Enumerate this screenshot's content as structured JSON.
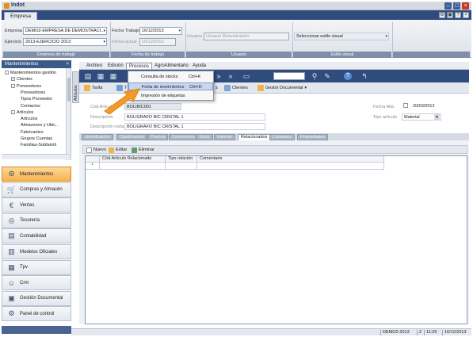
{
  "window": {
    "title": "Indot"
  },
  "ribbon": {
    "tab": "Empresa",
    "empresa_label": "Empresa",
    "empresa_value": "DEMO2-EMPRESA DE DEMOSTRACI...",
    "ejercicio_label": "Ejercicio",
    "ejercicio_value": "2013-EJERCICIO 2013",
    "group_empresa": "Empresa de trabajo",
    "fecha_trabajo_label": "Fecha Trabajo",
    "fecha_trabajo_value": "16/12/2013",
    "fecha_actual_label": "Fecha actual",
    "fecha_actual_value": "16/12/2013",
    "group_fecha": "Fecha de trabajo",
    "usuario_label": "Usuario",
    "usuario_value": "Usuario Demostración",
    "group_usuario": "Usuario",
    "estilo_value": "Seleccionar estilo visual",
    "group_estilo": "Estilo visual"
  },
  "sidebar": {
    "header": "Mantenimientos",
    "tree": [
      {
        "label": "Mantenimientos gestión",
        "indent": 0,
        "expander": "-"
      },
      {
        "label": "Clientes",
        "indent": 1,
        "expander": "+"
      },
      {
        "label": "Proveedores",
        "indent": 1,
        "expander": "-"
      },
      {
        "label": "Proveedores",
        "indent": 2,
        "expander": ""
      },
      {
        "label": "Tipos Proveedor",
        "indent": 2,
        "expander": ""
      },
      {
        "label": "Contactos",
        "indent": 2,
        "expander": ""
      },
      {
        "label": "Artículos",
        "indent": 1,
        "expander": "-"
      },
      {
        "label": "Artículos",
        "indent": 2,
        "expander": ""
      },
      {
        "label": "Almacenes y Ubic..",
        "indent": 2,
        "expander": ""
      },
      {
        "label": "Fabricantes",
        "indent": 2,
        "expander": ""
      },
      {
        "label": "Grupos Cuentas",
        "indent": 2,
        "expander": ""
      },
      {
        "label": "Familias-Subfamili",
        "indent": 2,
        "expander": ""
      }
    ],
    "nav": [
      {
        "label": "Mantenimientos",
        "icon": "gear-icon",
        "active": true
      },
      {
        "label": "Compras y Almacén",
        "icon": "cart-icon",
        "active": false
      },
      {
        "label": "Ventas",
        "icon": "euro-icon",
        "active": false
      },
      {
        "label": "Tesorería",
        "icon": "coins-icon",
        "active": false
      },
      {
        "label": "Contabilidad",
        "icon": "ledger-icon",
        "active": false
      },
      {
        "label": "Modelos Oficiales",
        "icon": "document-icon",
        "active": false
      },
      {
        "label": "Tpv",
        "icon": "pos-icon",
        "active": false
      },
      {
        "label": "Crm",
        "icon": "people-icon",
        "active": false
      },
      {
        "label": "Gestión Documental",
        "icon": "folder-icon",
        "active": false
      },
      {
        "label": "Panel de control",
        "icon": "settings-icon",
        "active": false
      }
    ]
  },
  "vertical_tab": "Artículos",
  "menu": [
    "Archivo",
    "Edición",
    "Procesos",
    "AgroAlimentario",
    "Ayuda"
  ],
  "dropdown": [
    {
      "label": "Consulta de stocks",
      "shortcut": "Ctrl+K",
      "highlight": false
    },
    {
      "label": "Ficha de movimientos",
      "shortcut": "Ctrl+D",
      "highlight": true
    },
    {
      "label": "Impresión de etiquetas",
      "shortcut": "",
      "highlight": false
    }
  ],
  "toolbar2": {
    "tarifa": "Tarifa",
    "t_partial": "T",
    "clientes": "Clientes",
    "gestor": "Gestor Documental",
    "n_partial": "s"
  },
  "form": {
    "cod_label": "Cód.Artículo",
    "cod_value": "BOLIBIC001",
    "desc_label": "Descripción",
    "desc_value": "BOLIGRAFO BIC CRISTAL 1",
    "descc_label": "Descripción corta",
    "descc_value": "BOLIGRAFO BIC CRISTAL 1",
    "fecha_alta_label": "Fecha Alta",
    "fecha_alta_value": "20/03/2012",
    "tipo_label": "Tipo artículo",
    "tipo_value": "Material"
  },
  "detail_tabs": [
    "Identificación",
    "Clasificación",
    "Precios",
    "Comisiones",
    "Stock",
    "Internet",
    "Relacionados",
    "Contratos",
    "Propiedades"
  ],
  "active_detail_tab": "Relacionados",
  "subbar": {
    "nuevo": "Nuevo",
    "editar": "Editar",
    "eliminar": "Eliminar"
  },
  "grid": {
    "columns": [
      "Cód.Artículo Relacionado",
      "Tipo relación",
      "Comentario"
    ],
    "row_marker": "*"
  },
  "status": [
    "DEMO2-2013",
    "2",
    "11:29",
    "16/12/2013"
  ]
}
